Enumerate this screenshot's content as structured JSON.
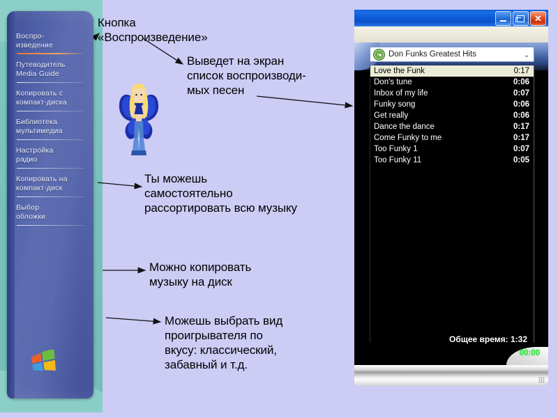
{
  "slide": {
    "background_color": "#ccccf5"
  },
  "sidebar": {
    "title": "Windows Media Player taskbar",
    "items": [
      {
        "line1": "Воспро-",
        "line2": "изведение",
        "accent": true
      },
      {
        "line1": "Путеводитель",
        "line2": "Media Guide",
        "accent": false
      },
      {
        "line1": "Копировать с",
        "line2": "компакт-диска",
        "accent": false
      },
      {
        "line1": "Библиотека",
        "line2": "мультимедиа",
        "accent": false
      },
      {
        "line1": "Настройка",
        "line2": "радио",
        "accent": false
      },
      {
        "line1": "Копировать на",
        "line2": "компакт-диск",
        "accent": false
      },
      {
        "line1": "Выбор",
        "line2": "обложки",
        "accent": false
      }
    ],
    "logo": "windows-flag-logo"
  },
  "annotations": [
    {
      "id": "ann-play-button",
      "text": "Кнопка\n«Воспроизведение»"
    },
    {
      "id": "ann-screen-list",
      "text": "Выведет на экран\nсписок воспроизводи-\nмых песен"
    },
    {
      "id": "ann-sort",
      "text": "Ты можешь\nсамостоятельно\nрассортировать всю музыку"
    },
    {
      "id": "ann-copy",
      "text": "Можно копировать\nмузыку на диск"
    },
    {
      "id": "ann-skin",
      "text": "Можешь выбрать вид\nпроигрывателя по\nвкусу: классический,\nзабавный и т.д."
    }
  ],
  "player": {
    "titlebar": {
      "title": "",
      "minimize_label": "Свернуть",
      "restore_label": "Восстановить",
      "close_label": "Закрыть",
      "close_glyph": "✕"
    },
    "playlist_selector": {
      "icon": "cd-disc-icon",
      "value": "Don Funks Greatest Hits",
      "arrow_glyph": "⌄"
    },
    "tracks": [
      {
        "name": "Love the Funk",
        "time": "0:17",
        "selected": true
      },
      {
        "name": "Don's tune",
        "time": "0:06",
        "selected": false
      },
      {
        "name": "Inbox of my life",
        "time": "0:07",
        "selected": false
      },
      {
        "name": "Funky song",
        "time": "0:06",
        "selected": false
      },
      {
        "name": "Get really",
        "time": "0:06",
        "selected": false
      },
      {
        "name": "Dance the dance",
        "time": "0:17",
        "selected": false
      },
      {
        "name": "Come Funky to me",
        "time": "0:17",
        "selected": false
      },
      {
        "name": "Too Funky 1",
        "time": "0:07",
        "selected": false
      },
      {
        "name": "Too Funky 11",
        "time": "0:05",
        "selected": false
      }
    ],
    "total_time": "Общее время: 1:32",
    "elapsed_time": "00:00",
    "colors": {
      "titlebar": "#0b5ad6",
      "close_button": "#e24e23",
      "playlist_background": "#000000",
      "selected_row": "#ebebd6",
      "timer_green": "#2fe03a"
    }
  },
  "fairy": {
    "alt": "pixel-art fairy with blue butterfly wings"
  }
}
